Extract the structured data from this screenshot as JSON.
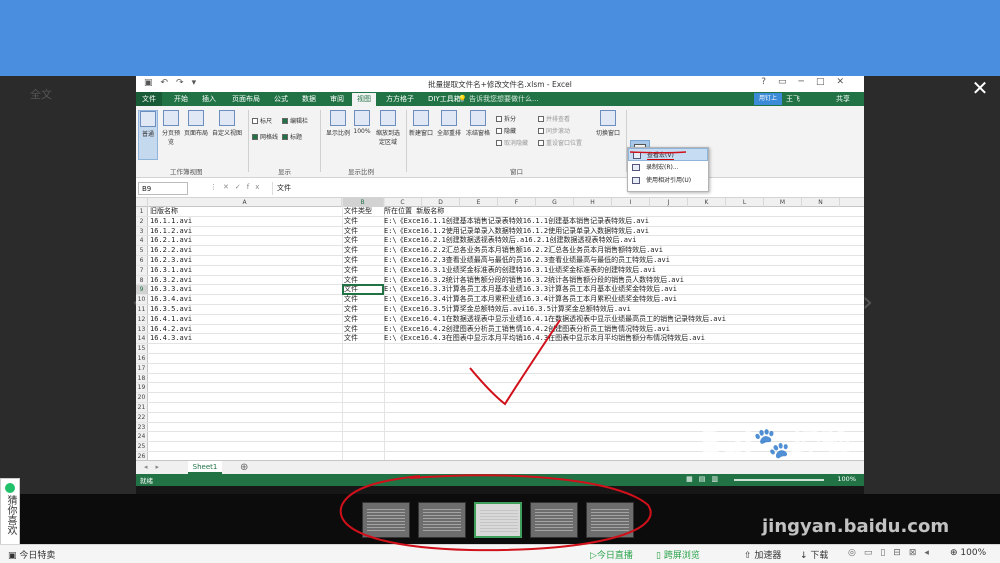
{
  "viewer": {
    "left_label": "全文",
    "close_icon": "close-icon",
    "prev_icon": "chevron-left-icon",
    "next_icon": "chevron-right-icon",
    "side_card_text": "猜你喜欢"
  },
  "excel": {
    "title": "批量提取文件名+修改文件名.xlsm - Excel",
    "tabs": [
      "文件",
      "开始",
      "插入",
      "页面布局",
      "公式",
      "数据",
      "审阅",
      "视图",
      "方方格子",
      "DIY工具箱"
    ],
    "active_tab": "视图",
    "tell_me": "告诉我您想要做什么...",
    "share_login": "用钉上",
    "user": "王飞",
    "share": "共享",
    "ribbon": {
      "workbook_views": {
        "label": "工作簿视图",
        "buttons": [
          "普通",
          "分页预览",
          "页面布局",
          "自定义视图"
        ]
      },
      "show": {
        "label": "显示",
        "checks": [
          {
            "text": "标尺",
            "checked": false
          },
          {
            "text": "编辑栏",
            "checked": true
          },
          {
            "text": "网格线",
            "checked": true
          },
          {
            "text": "标题",
            "checked": true
          }
        ]
      },
      "zoom": {
        "label": "显示比例",
        "buttons": [
          "显示比例",
          "100%",
          "缩放到选定区域"
        ]
      },
      "window": {
        "label": "窗口",
        "buttons": [
          "新建窗口",
          "全部重排",
          "冻结窗格"
        ],
        "small": [
          "拆分",
          "隐藏",
          "取消隐藏",
          "并排查看",
          "同步滚动",
          "重设窗口位置"
        ],
        "switch": "切换窗口"
      },
      "macro": {
        "label": "宏",
        "menu": [
          "查看宏(V)",
          "录制宏(R)...",
          "使用相对引用(U)"
        ]
      }
    },
    "name_box": "B9",
    "formula": "文件",
    "columns": [
      "A",
      "B",
      "C",
      "D",
      "E",
      "F",
      "G",
      "H",
      "I",
      "J",
      "K",
      "L",
      "M",
      "N"
    ],
    "rows": [
      {
        "n": "1",
        "a": "旧版名称",
        "b": "文件类型",
        "c": "所在位置  新版名称"
      },
      {
        "n": "2",
        "a": "16.1.1.avi",
        "b": "文件",
        "c": "E:\\《Exce16.1.1创建基本销售记录表特效16.1.1创建基本销售记录表特效后.avi"
      },
      {
        "n": "3",
        "a": "16.1.2.avi",
        "b": "文件",
        "c": "E:\\《Exce16.1.2使用记录单录入数据特效16.1.2使用记录单录入数据特效后.avi"
      },
      {
        "n": "4",
        "a": "16.2.1.avi",
        "b": "文件",
        "c": "E:\\《Exce16.2.1创建数据透视表特效后.a16.2.1创建数据透视表特效后.avi"
      },
      {
        "n": "5",
        "a": "16.2.2.avi",
        "b": "文件",
        "c": "E:\\《Exce16.2.2汇总各业务员本月销售额16.2.2汇总各业务员本月销售额特效后.avi"
      },
      {
        "n": "6",
        "a": "16.2.3.avi",
        "b": "文件",
        "c": "E:\\《Exce16.2.3查看业绩最高与最低的员16.2.3查看业绩最高与最低的员工特效后.avi"
      },
      {
        "n": "7",
        "a": "16.3.1.avi",
        "b": "文件",
        "c": "E:\\《Exce16.3.1业绩奖金标准表的创建特16.3.1业绩奖金标准表的创建特效后.avi"
      },
      {
        "n": "8",
        "a": "16.3.2.avi",
        "b": "文件",
        "c": "E:\\《Exce16.3.2统计各销售额分段的销售16.3.2统计各销售额分段的销售员人数特效后.avi"
      },
      {
        "n": "9",
        "a": "16.3.3.avi",
        "b": "文件",
        "c": "E:\\《Exce16.3.3计算各员工本月基本业绩16.3.3计算各员工本月基本业绩奖金特效后.avi"
      },
      {
        "n": "10",
        "a": "16.3.4.avi",
        "b": "文件",
        "c": "E:\\《Exce16.3.4计算各员工本月累积业绩16.3.4计算各员工本月累积业绩奖金特效后.avi"
      },
      {
        "n": "11",
        "a": "16.3.5.avi",
        "b": "文件",
        "c": "E:\\《Exce16.3.5计算奖金总额特效后.avi16.3.5计算奖金总额特效后.avi"
      },
      {
        "n": "12",
        "a": "16.4.1.avi",
        "b": "文件",
        "c": "E:\\《Exce16.4.1在数据透视表中显示业绩16.4.1在数据透视表中显示业绩最高员工的销售记录特效后.avi"
      },
      {
        "n": "13",
        "a": "16.4.2.avi",
        "b": "文件",
        "c": "E:\\《Exce16.4.2创建图表分析员工销售情16.4.2创建图表分析员工销售情况特效后.avi"
      },
      {
        "n": "14",
        "a": "16.4.3.avi",
        "b": "文件",
        "c": "E:\\《Exce16.4.3在图表中显示本月平均销16.4.3在图表中显示本月平均销售额分布情况特效后.avi"
      },
      {
        "n": "15",
        "a": "",
        "b": "",
        "c": ""
      },
      {
        "n": "16",
        "a": "",
        "b": "",
        "c": ""
      },
      {
        "n": "17",
        "a": "",
        "b": "",
        "c": ""
      },
      {
        "n": "18",
        "a": "",
        "b": "",
        "c": ""
      },
      {
        "n": "19",
        "a": "",
        "b": "",
        "c": ""
      },
      {
        "n": "20",
        "a": "",
        "b": "",
        "c": ""
      },
      {
        "n": "21",
        "a": "",
        "b": "",
        "c": ""
      },
      {
        "n": "22",
        "a": "",
        "b": "",
        "c": ""
      },
      {
        "n": "23",
        "a": "",
        "b": "",
        "c": ""
      },
      {
        "n": "24",
        "a": "",
        "b": "",
        "c": ""
      },
      {
        "n": "25",
        "a": "",
        "b": "",
        "c": ""
      },
      {
        "n": "26",
        "a": "",
        "b": "",
        "c": ""
      }
    ],
    "sheet_tab": "Sheet1",
    "status": "就绪",
    "zoom": "100%"
  },
  "watermark": {
    "brand": "Bai",
    "brand_suffix": "经验",
    "url": "jingyan.baidu.com"
  },
  "bottom_bar": {
    "deals": "今日特卖",
    "live": "今日直播",
    "cross_screen": "跨屏浏览",
    "accelerator": "加速器",
    "download": "下载",
    "zoom": "100%"
  },
  "colors": {
    "excel_green": "#217346",
    "top_blue": "#4a8ee0",
    "annotation_red": "#d0101a"
  }
}
